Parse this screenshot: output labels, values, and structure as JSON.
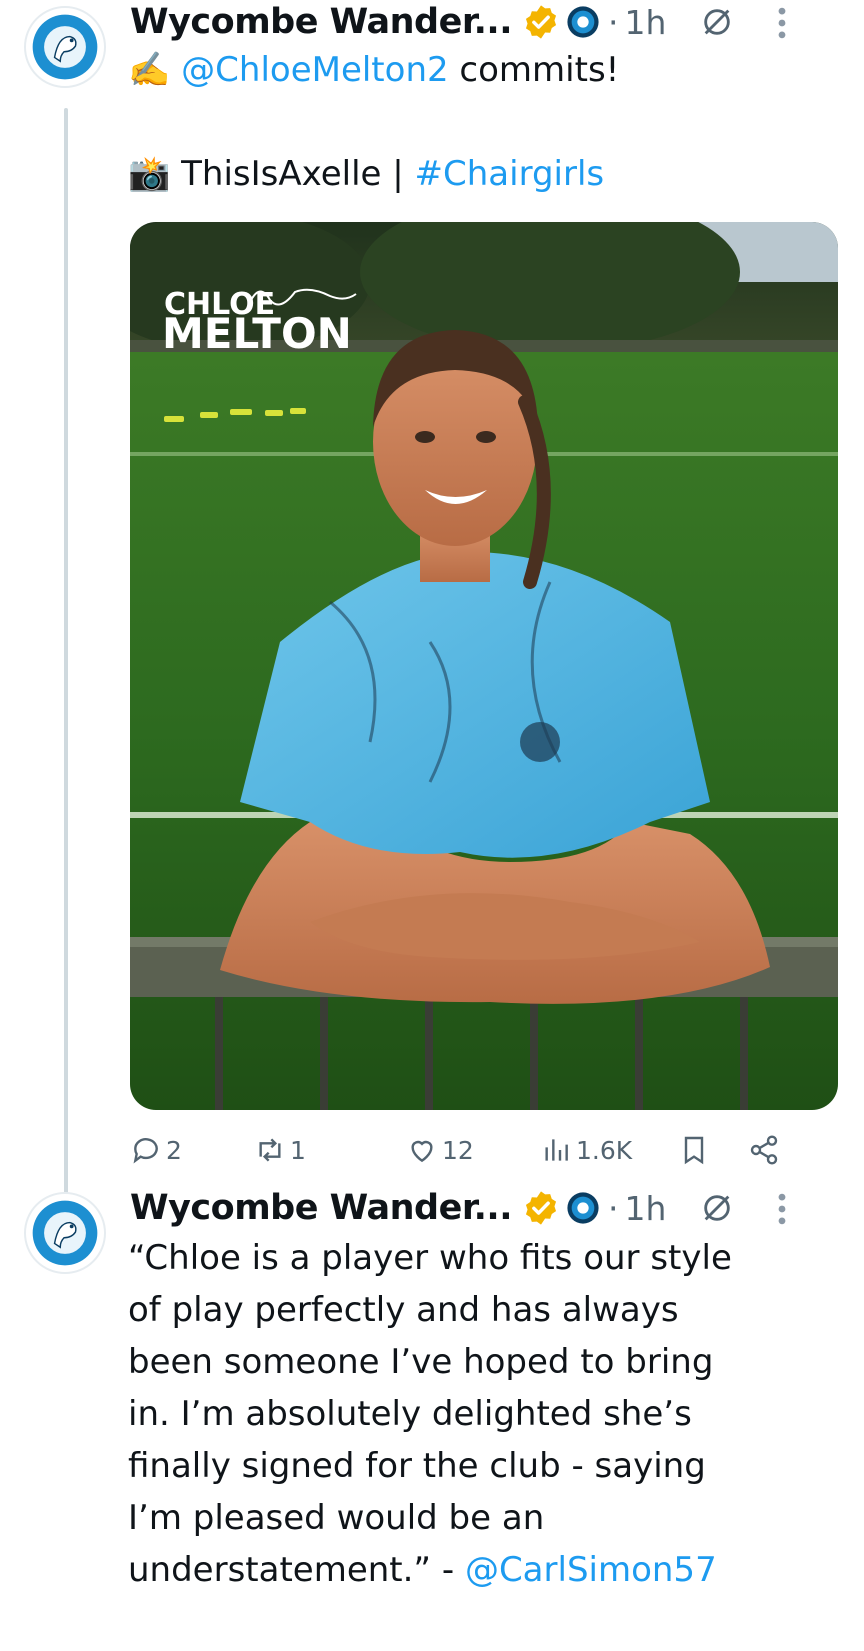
{
  "tweets": [
    {
      "author_name": "Wycombe Wander...",
      "time": "1h",
      "separator": "·",
      "line1_emoji": "✍️",
      "line1_mention": "@ChloeMelton2",
      "line1_rest": " commits!",
      "line2_emoji": "📸",
      "line2_text": " ThisIsAxelle | ",
      "line2_hashtag": "#Chairgirls",
      "photo_overlay": {
        "first": "CHLOE",
        "last": "MELTON"
      },
      "actions": {
        "replies": "2",
        "reposts": "1",
        "likes": "12",
        "views": "1.6K"
      }
    },
    {
      "author_name": "Wycombe Wander...",
      "time": "1h",
      "separator": "·",
      "body_lines": [
        "“Chloe is a player who fits our style",
        "of play perfectly and has always",
        "been someone I’ve hoped to bring",
        "in. I’m absolutely delighted she’s",
        "finally signed for the club - saying",
        "I’m pleased would be an"
      ],
      "last_line_text": "understatement.” - ",
      "last_line_mention": "@CarlSimon57"
    }
  ],
  "colors": {
    "link": "#1d9bf0",
    "secondary": "#536471",
    "verified_gold": "#f4b400",
    "club_blue": "#1d8fd1"
  },
  "icons": [
    "club-logo-icon",
    "verified-badge-icon",
    "affiliate-badge-icon",
    "grok-icon",
    "more-icon",
    "reply-icon",
    "repost-icon",
    "like-icon",
    "views-icon",
    "bookmark-icon",
    "share-icon"
  ]
}
